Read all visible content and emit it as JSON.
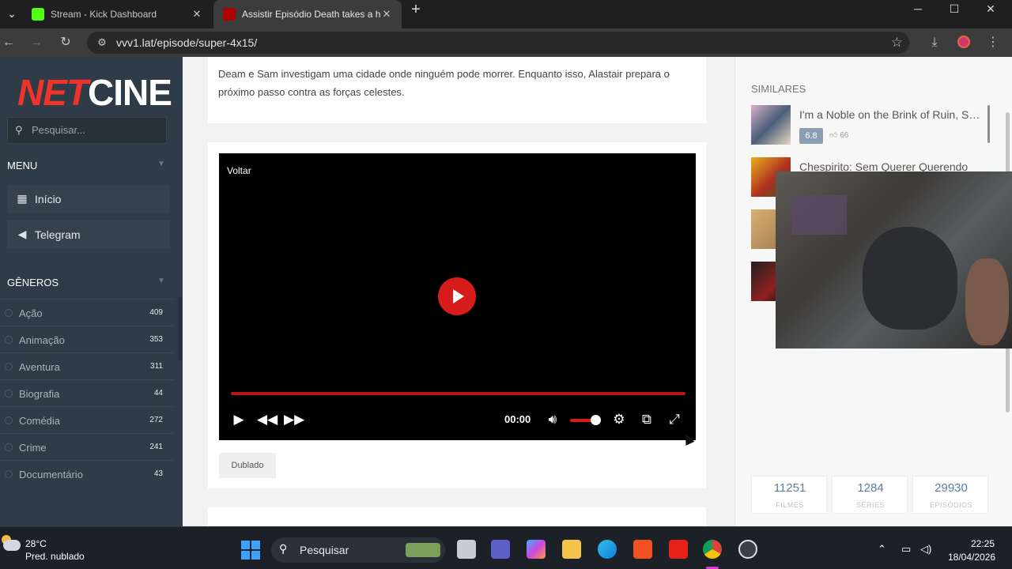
{
  "browser": {
    "tabs": [
      {
        "title": "Stream - Kick Dashboard",
        "active": false
      },
      {
        "title": "Assistir Episódio Death takes a h",
        "active": true
      }
    ],
    "new_tab_icon": "plus-icon",
    "url": "vvv1.lat/episode/super-4x15/",
    "window_controls": [
      "minimize-icon",
      "maximize-icon",
      "close-icon"
    ]
  },
  "sidebar": {
    "logo_part1": "NET",
    "logo_part2": "CINE",
    "search_placeholder": "Pesquisar...",
    "menu_heading": "MENU",
    "menu_items": [
      {
        "label": "Início",
        "icon": "film-icon"
      },
      {
        "label": "Telegram",
        "icon": "megaphone-icon"
      }
    ],
    "genres_heading": "GÊNEROS",
    "genres": [
      {
        "name": "Ação",
        "count": "409"
      },
      {
        "name": "Animação",
        "count": "353"
      },
      {
        "name": "Aventura",
        "count": "311"
      },
      {
        "name": "Biografia",
        "count": "44"
      },
      {
        "name": "Comédia",
        "count": "272"
      },
      {
        "name": "Crime",
        "count": "241"
      },
      {
        "name": "Documentário",
        "count": "43"
      }
    ]
  },
  "episode": {
    "synopsis": "Deam e Sam investigam uma cidade onde ninguém pode morrer. Enquanto isso, Alastair prepara o próximo passo contra as forças celestes."
  },
  "player": {
    "back_label": "Voltar",
    "time": "00:00",
    "progress": 0,
    "volume": 0.85,
    "language_badge": "Dublado"
  },
  "similares": {
    "heading": "SIMILARES",
    "items": [
      {
        "title": "I'm a Noble on the Brink of Ruin, So I Might as Well Try Mastering Magic",
        "rating": "6.8",
        "likes": "66"
      },
      {
        "title": "Chespirito: Sem Querer Querendo",
        "rating": "",
        "likes": ""
      }
    ]
  },
  "stats": [
    {
      "value": "11251",
      "label": "FILMES"
    },
    {
      "value": "1284",
      "label": "SÉRIES"
    },
    {
      "value": "29930",
      "label": "EPISÓDIOS"
    }
  ],
  "taskbar": {
    "temperature": "28°C",
    "weather": "Pred. nublado",
    "search_label": "Pesquisar",
    "time": "22:25",
    "date": "18/04/2026"
  },
  "colors": {
    "accent_red": "#d81c1c",
    "sidebar_bg": "#2f3b46",
    "stat_blue": "#5b7da0"
  }
}
